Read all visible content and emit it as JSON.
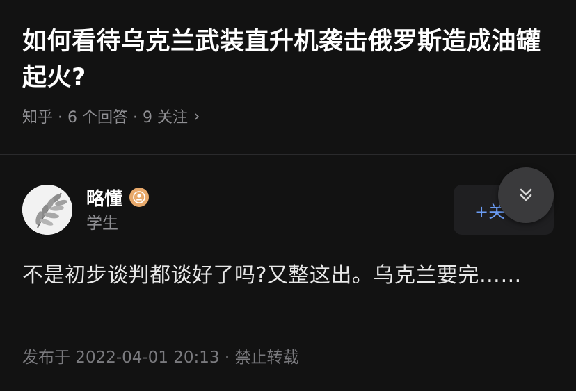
{
  "question": {
    "title": "如何看待乌克兰武装直升机袭击俄罗斯造成油罐起火?",
    "meta": "知乎 · 6 个回答 · 9 关注",
    "chevron": "›"
  },
  "answer": {
    "author": {
      "name": "略懂",
      "bio": "学生",
      "badge_icon": "user-badge-icon"
    },
    "follow_label": "+关",
    "content": "不是初步谈判都谈好了吗?又整这出。乌克兰要完……",
    "meta": "发布于 2022-04-01 20:13 · 禁止转载"
  },
  "icons": {
    "collapse": "chevrons-down-icon",
    "avatar": "leaf-avatar"
  },
  "colors": {
    "background": "#121212",
    "accent": "#6b9cf4",
    "badge": "#e8a96b",
    "muted_text": "#8f8f93"
  }
}
